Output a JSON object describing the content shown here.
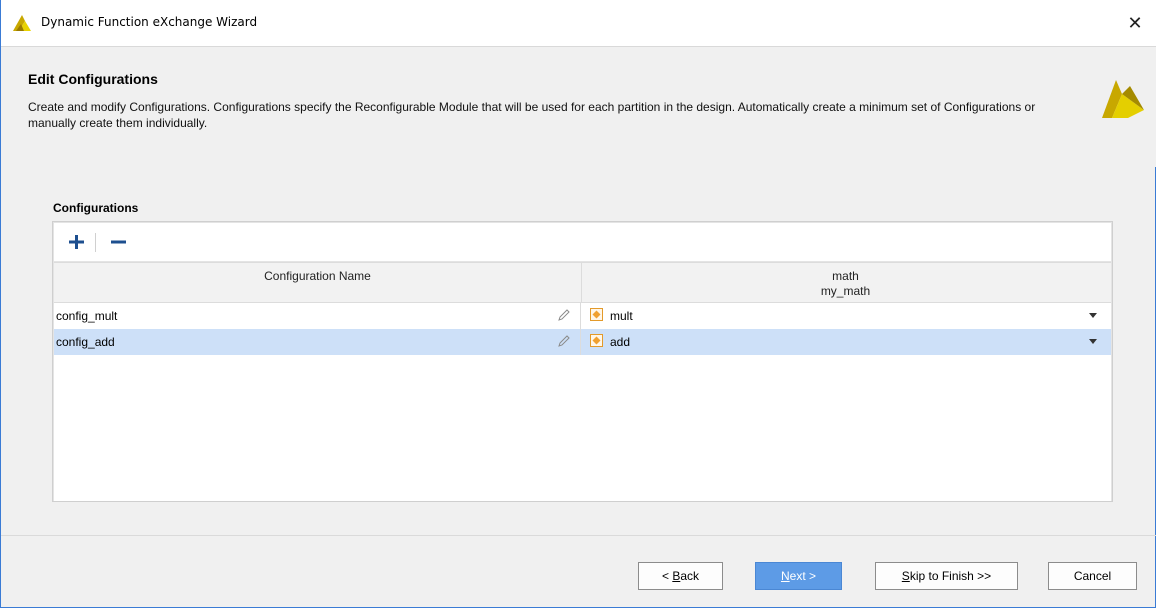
{
  "window": {
    "title": "Dynamic Function eXchange Wizard",
    "close_glyph": "✕"
  },
  "header": {
    "title": "Edit Configurations",
    "description": "Create and modify Configurations. Configurations specify the Reconfigurable Module that will be used for each partition in the design. Automatically create a minimum set of Configurations or manually create them individually."
  },
  "configurations": {
    "label": "Configurations",
    "toolbar": {
      "add_icon": "plus-icon",
      "remove_icon": "minus-icon"
    },
    "columns": [
      {
        "label": "Configuration Name"
      },
      {
        "label": "math",
        "sublabel": "my_math"
      }
    ],
    "rows": [
      {
        "name": "config_mult",
        "module": "mult",
        "selected": false
      },
      {
        "name": "config_add",
        "module": "add",
        "selected": true
      }
    ]
  },
  "footer": {
    "back": {
      "prefix": "< ",
      "mnemonic": "B",
      "rest": "ack"
    },
    "next": {
      "mnemonic": "N",
      "rest": "ext >"
    },
    "skip": {
      "mnemonic": "S",
      "rest": "kip to Finish >>"
    },
    "cancel": "Cancel"
  },
  "colors": {
    "accent": "#5d9be6",
    "selection": "#cde0f8",
    "module_icon": "#f0a030"
  }
}
